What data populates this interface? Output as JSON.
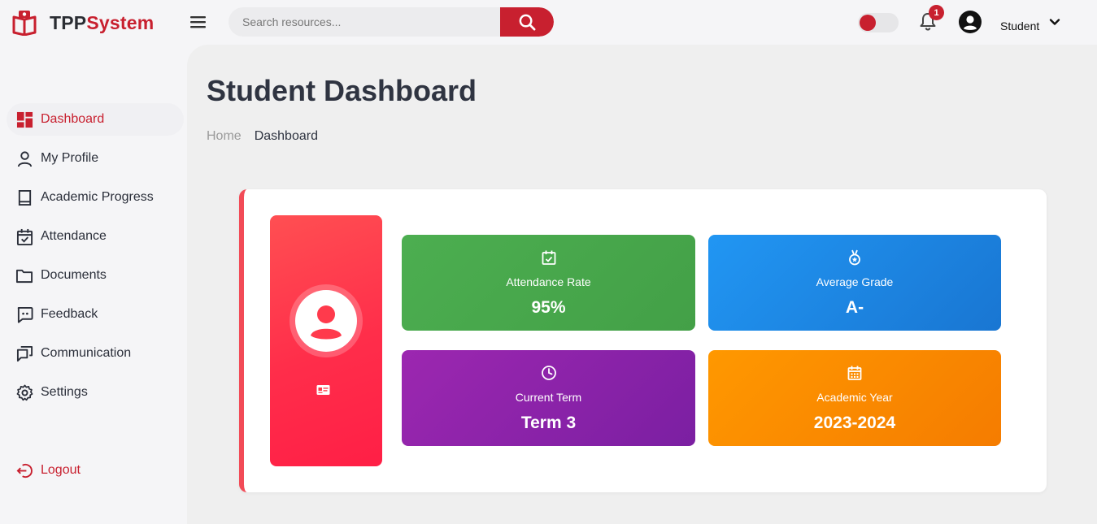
{
  "app": {
    "logo_part1": "TPP",
    "logo_part2": "System",
    "brand_color": "#c8202f"
  },
  "search": {
    "placeholder": "Search resources..."
  },
  "header": {
    "notification_count": "1",
    "user_name": "Student"
  },
  "sidebar": {
    "items": [
      {
        "label": "Dashboard",
        "icon": "dashboard-icon",
        "active": true
      },
      {
        "label": "My Profile",
        "icon": "user-icon"
      },
      {
        "label": "Academic Progress",
        "icon": "book-icon"
      },
      {
        "label": "Attendance",
        "icon": "calendar-check-icon"
      },
      {
        "label": "Documents",
        "icon": "folder-icon"
      },
      {
        "label": "Feedback",
        "icon": "chat-icon"
      },
      {
        "label": "Communication",
        "icon": "messages-icon"
      },
      {
        "label": "Settings",
        "icon": "gear-icon"
      }
    ],
    "logout": {
      "label": "Logout",
      "icon": "logout-icon"
    }
  },
  "main": {
    "title": "Student Dashboard",
    "breadcrumb": {
      "home": "Home",
      "current": "Dashboard"
    }
  },
  "stats": [
    {
      "label": "Attendance Rate",
      "value": "95%",
      "icon": "calendar-check-icon",
      "color": "#4caf50"
    },
    {
      "label": "Average Grade",
      "value": "A-",
      "icon": "medal-icon",
      "color": "#2196f3"
    },
    {
      "label": "Current Term",
      "value": "Term 3",
      "icon": "clock-icon",
      "color": "#9c27b0"
    },
    {
      "label": "Academic Year",
      "value": "2023-2024",
      "icon": "calendar-icon",
      "color": "#ff9800"
    }
  ]
}
